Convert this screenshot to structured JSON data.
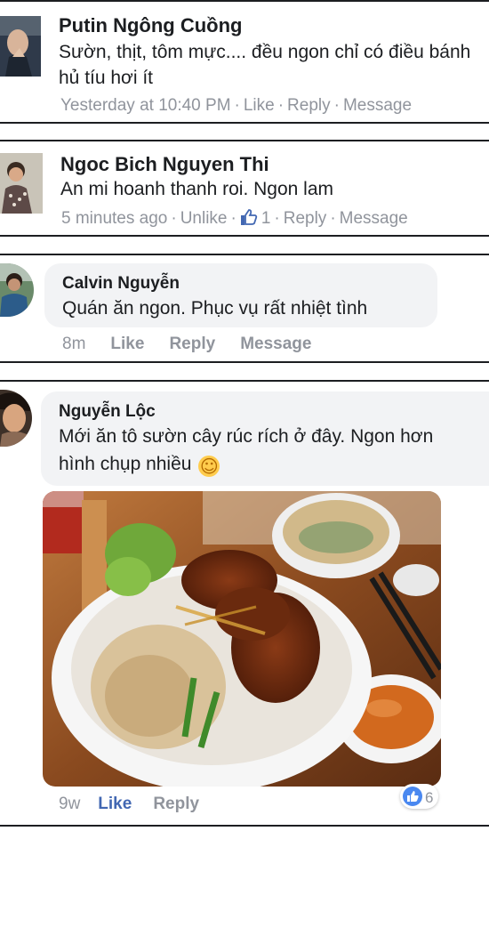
{
  "comments": [
    {
      "author": "Putin Ngông Cuồng",
      "text": "Sườn, thịt, tôm mực.... đều ngon chỉ có điều bánh hủ tíu hơi ít",
      "time": "Yesterday at 10:40 PM",
      "like": "Like",
      "reply": "Reply",
      "message": "Message",
      "sep": "·"
    },
    {
      "author": "Ngoc Bich Nguyen Thi",
      "text": "An mi hoanh thanh roi. Ngon lam",
      "time": "5 minutes ago",
      "like": "Unlike",
      "like_count": "1",
      "reply": "Reply",
      "message": "Message",
      "sep": "·"
    },
    {
      "author": "Calvin Nguyễn",
      "text": "Quán ăn ngon. Phục vụ rất nhiệt tình",
      "time": "8m",
      "like": "Like",
      "reply": "Reply",
      "message": "Message"
    },
    {
      "author": "Nguyễn Lộc",
      "text_line1": "Mới ăn tô sườn cây rúc rích ở đây. Ngon hơn",
      "text_line2": "hình chụp nhiều",
      "emoji": "☺",
      "time": "9w",
      "like": "Like",
      "reply": "Reply",
      "reaction_count": "6"
    }
  ],
  "colors": {
    "text": "#1c1e21",
    "meta": "#90949c",
    "link_blue": "#4267b2",
    "bubble": "#f2f3f5"
  },
  "icons": {
    "thumbs_up": "thumbs-up-icon",
    "like_reaction": "like-reaction-icon"
  }
}
